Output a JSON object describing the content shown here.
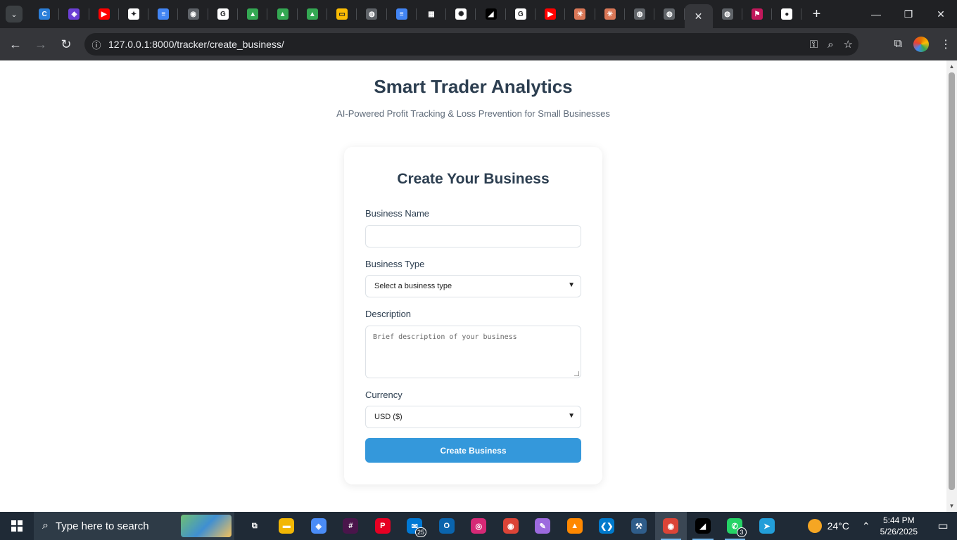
{
  "browser": {
    "tabs": [
      {
        "icon": "copilot-icon",
        "color": "#2b7fd9",
        "glyph": "C"
      },
      {
        "icon": "shield-app-icon",
        "color": "#6b3fd4",
        "glyph": "◈"
      },
      {
        "icon": "youtube-icon",
        "color": "#ff0000",
        "glyph": "▶"
      },
      {
        "icon": "sparkle-icon",
        "color": "#ffffff",
        "glyph": "✦"
      },
      {
        "icon": "docs-icon",
        "color": "#4285f4",
        "glyph": "≡"
      },
      {
        "icon": "chrome-icon",
        "color": "#5f6368",
        "glyph": "◉"
      },
      {
        "icon": "google-icon",
        "color": "#ffffff",
        "glyph": "G"
      },
      {
        "icon": "drive-icon",
        "color": "#34a853",
        "glyph": "▲"
      },
      {
        "icon": "drive-icon",
        "color": "#34a853",
        "glyph": "▲"
      },
      {
        "icon": "drive-icon",
        "color": "#34a853",
        "glyph": "▲"
      },
      {
        "icon": "slides-icon",
        "color": "#fbbc04",
        "glyph": "▭"
      },
      {
        "icon": "globe-icon",
        "color": "#5f6368",
        "glyph": "◍"
      },
      {
        "icon": "docs-icon",
        "color": "#4285f4",
        "glyph": "≡"
      },
      {
        "icon": "qr-icon",
        "color": "#202124",
        "glyph": "▦"
      },
      {
        "icon": "openai-icon",
        "color": "#ffffff",
        "glyph": "✺"
      },
      {
        "icon": "capcut-icon",
        "color": "#000000",
        "glyph": "◢"
      },
      {
        "icon": "google-icon",
        "color": "#ffffff",
        "glyph": "G"
      },
      {
        "icon": "youtube-icon",
        "color": "#ff0000",
        "glyph": "▶"
      },
      {
        "icon": "claude-icon",
        "color": "#d97757",
        "glyph": "✳"
      },
      {
        "icon": "claude-icon",
        "color": "#d97757",
        "glyph": "✳"
      },
      {
        "icon": "globe-icon",
        "color": "#5f6368",
        "glyph": "◍"
      },
      {
        "icon": "globe-icon",
        "color": "#5f6368",
        "glyph": "◍"
      }
    ],
    "after_tabs": [
      {
        "icon": "globe-icon",
        "color": "#5f6368",
        "glyph": "◍"
      },
      {
        "icon": "flag-icon",
        "color": "#c2185b",
        "glyph": "⚑"
      },
      {
        "icon": "github-icon",
        "color": "#ffffff",
        "glyph": "●"
      }
    ],
    "active_tab_close": "✕",
    "new_tab": "+",
    "url": "127.0.0.1:8000/tracker/create_business/"
  },
  "page": {
    "title": "Smart Trader Analytics",
    "subtitle": "AI-Powered Profit Tracking & Loss Prevention for Small Businesses",
    "form": {
      "heading": "Create Your Business",
      "business_name": {
        "label": "Business Name",
        "value": ""
      },
      "business_type": {
        "label": "Business Type",
        "selected": "Select a business type"
      },
      "description": {
        "label": "Description",
        "placeholder": "Brief description of your business"
      },
      "currency": {
        "label": "Currency",
        "selected": "USD ($)"
      },
      "submit_label": "Create Business"
    },
    "accent_color": "#3498db"
  },
  "taskbar": {
    "search_placeholder": "Type here to search",
    "apps": [
      {
        "name": "task-view-icon",
        "color": "transparent",
        "glyph": "⧉",
        "running": false
      },
      {
        "name": "file-explorer-icon",
        "color": "#f2b705",
        "glyph": "▬",
        "running": false
      },
      {
        "name": "copilot-app-icon",
        "color": "#4a8cf7",
        "glyph": "◈",
        "running": false
      },
      {
        "name": "slack-icon",
        "color": "#4a154b",
        "glyph": "#",
        "running": false
      },
      {
        "name": "pinterest-icon",
        "color": "#e60023",
        "glyph": "P",
        "running": false
      },
      {
        "name": "mail-icon",
        "color": "#0078d4",
        "glyph": "✉",
        "running": false,
        "badge": "25"
      },
      {
        "name": "outlook-icon",
        "color": "#0a64ad",
        "glyph": "O",
        "running": false
      },
      {
        "name": "instagram-icon",
        "color": "#d62976",
        "glyph": "◎",
        "running": false
      },
      {
        "name": "chrome-app-icon",
        "color": "#db4437",
        "glyph": "◉",
        "running": false
      },
      {
        "name": "paint-icon",
        "color": "#9c6ade",
        "glyph": "✎",
        "running": false
      },
      {
        "name": "vlc-icon",
        "color": "#ff8800",
        "glyph": "▲",
        "running": false
      },
      {
        "name": "vscode-icon",
        "color": "#007acc",
        "glyph": "❮❯",
        "running": false
      },
      {
        "name": "mysql-workbench-icon",
        "color": "#2f5d8a",
        "glyph": "⚒",
        "running": false
      },
      {
        "name": "chrome-profile-icon",
        "color": "#db4437",
        "glyph": "◉",
        "running": true,
        "active": true
      },
      {
        "name": "capcut-app-icon",
        "color": "#000000",
        "glyph": "◢",
        "running": true
      },
      {
        "name": "whatsapp-icon",
        "color": "#25d366",
        "glyph": "✆",
        "running": true,
        "badge": "3"
      },
      {
        "name": "telegram-icon",
        "color": "#229ed9",
        "glyph": "➤",
        "running": false
      }
    ],
    "weather": "24°C",
    "time": "5:44 PM",
    "date": "5/26/2025"
  }
}
